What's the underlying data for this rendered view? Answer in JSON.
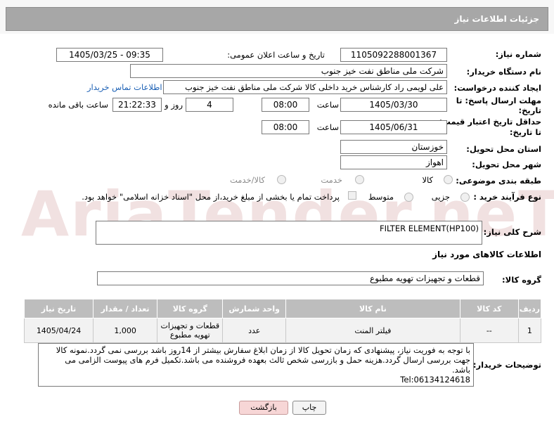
{
  "header": {
    "title": "جزئیات اطلاعات نیاز"
  },
  "labels": {
    "need_number": "شماره نیاز:",
    "announce_datetime": "تاریخ و ساعت اعلان عمومی:",
    "buyer_org": "نام دستگاه خریدار:",
    "requester": "ایجاد کننده درخواست:",
    "deadline_line1": "مهلت ارسال پاسخ: تا",
    "deadline_line2": "تاریخ:",
    "price_validity_line1": "حداقل تاریخ اعتبار قیمت:",
    "price_validity_line2": "تا تاریخ:",
    "time": "ساعت",
    "days_and": "روز و",
    "remaining": "ساعت باقی مانده",
    "province": "استان محل تحویل:",
    "city": "شهر محل تحویل:",
    "category": "طبقه بندی موضوعی:",
    "process_type": "نوع فرآیند خرید :",
    "general_desc": "شرح کلی نیاز:",
    "goods_info": "اطلاعات کالاهای مورد نیاز",
    "goods_group": "گروه کالا:",
    "buyer_notes": "توضیحات خریدار:"
  },
  "values": {
    "need_number": "1105092288001367",
    "announce_datetime": "1405/03/25 - 09:35",
    "buyer_org": "شرکت ملی مناطق نفت خیز جنوب",
    "requester": "علی  لویمی راد  کارشناس خرید داخلی کالا شرکت ملی مناطق نفت خیز جنوب",
    "contact_link": "اطلاعات تماس خریدار",
    "deadline_date": "1405/03/30",
    "deadline_time": "08:00",
    "days": "4",
    "remaining_time": "21:22:33",
    "price_validity_date": "1405/06/31",
    "price_validity_time": "08:00",
    "province": "خوزستان",
    "city": "اهواز",
    "general_desc": "FILTER ELEMENT(HP100)",
    "goods_group": "قطعات و تجهیزات تهویه مطبوع"
  },
  "category_options": [
    "کالا",
    "خدمت",
    "کالا/خدمت"
  ],
  "process_options": [
    "جزیی",
    "متوسط"
  ],
  "payment_note": "پرداخت تمام یا بخشی از مبلغ خرید،از محل \"اسناد خزانه اسلامی\" خواهد بود.",
  "watermark": "AriaTender.neT",
  "table": {
    "headers": [
      "ردیف",
      "کد کالا",
      "نام کالا",
      "واحد شمارش",
      "گروه کالا",
      "تعداد / مقدار",
      "تاریخ نیاز"
    ],
    "rows": [
      [
        "1",
        "--",
        "فیلتر المنت",
        "عدد",
        "قطعات و تجهیزات تهویه مطبوع",
        "1,000",
        "1405/04/24"
      ]
    ]
  },
  "buyer_notes": {
    "line1": "با توجه به فوریت نیاز، پیشنهادی که زمان تحویل کالا از زمان ابلاغ سفارش بیشتر از 14روز باشد بررسی نمی گردد.نمونه کالا",
    "line2": "جهت بررسی ارسال گردد.هزینه حمل و بازرسی شخص ثالث بعهده فروشنده می باشد.تکمیل فرم های پیوست الزامی می",
    "line3": "باشد.",
    "line4": "Tel:06134124618"
  },
  "buttons": {
    "print": "چاپ",
    "back": "بازگشت"
  }
}
